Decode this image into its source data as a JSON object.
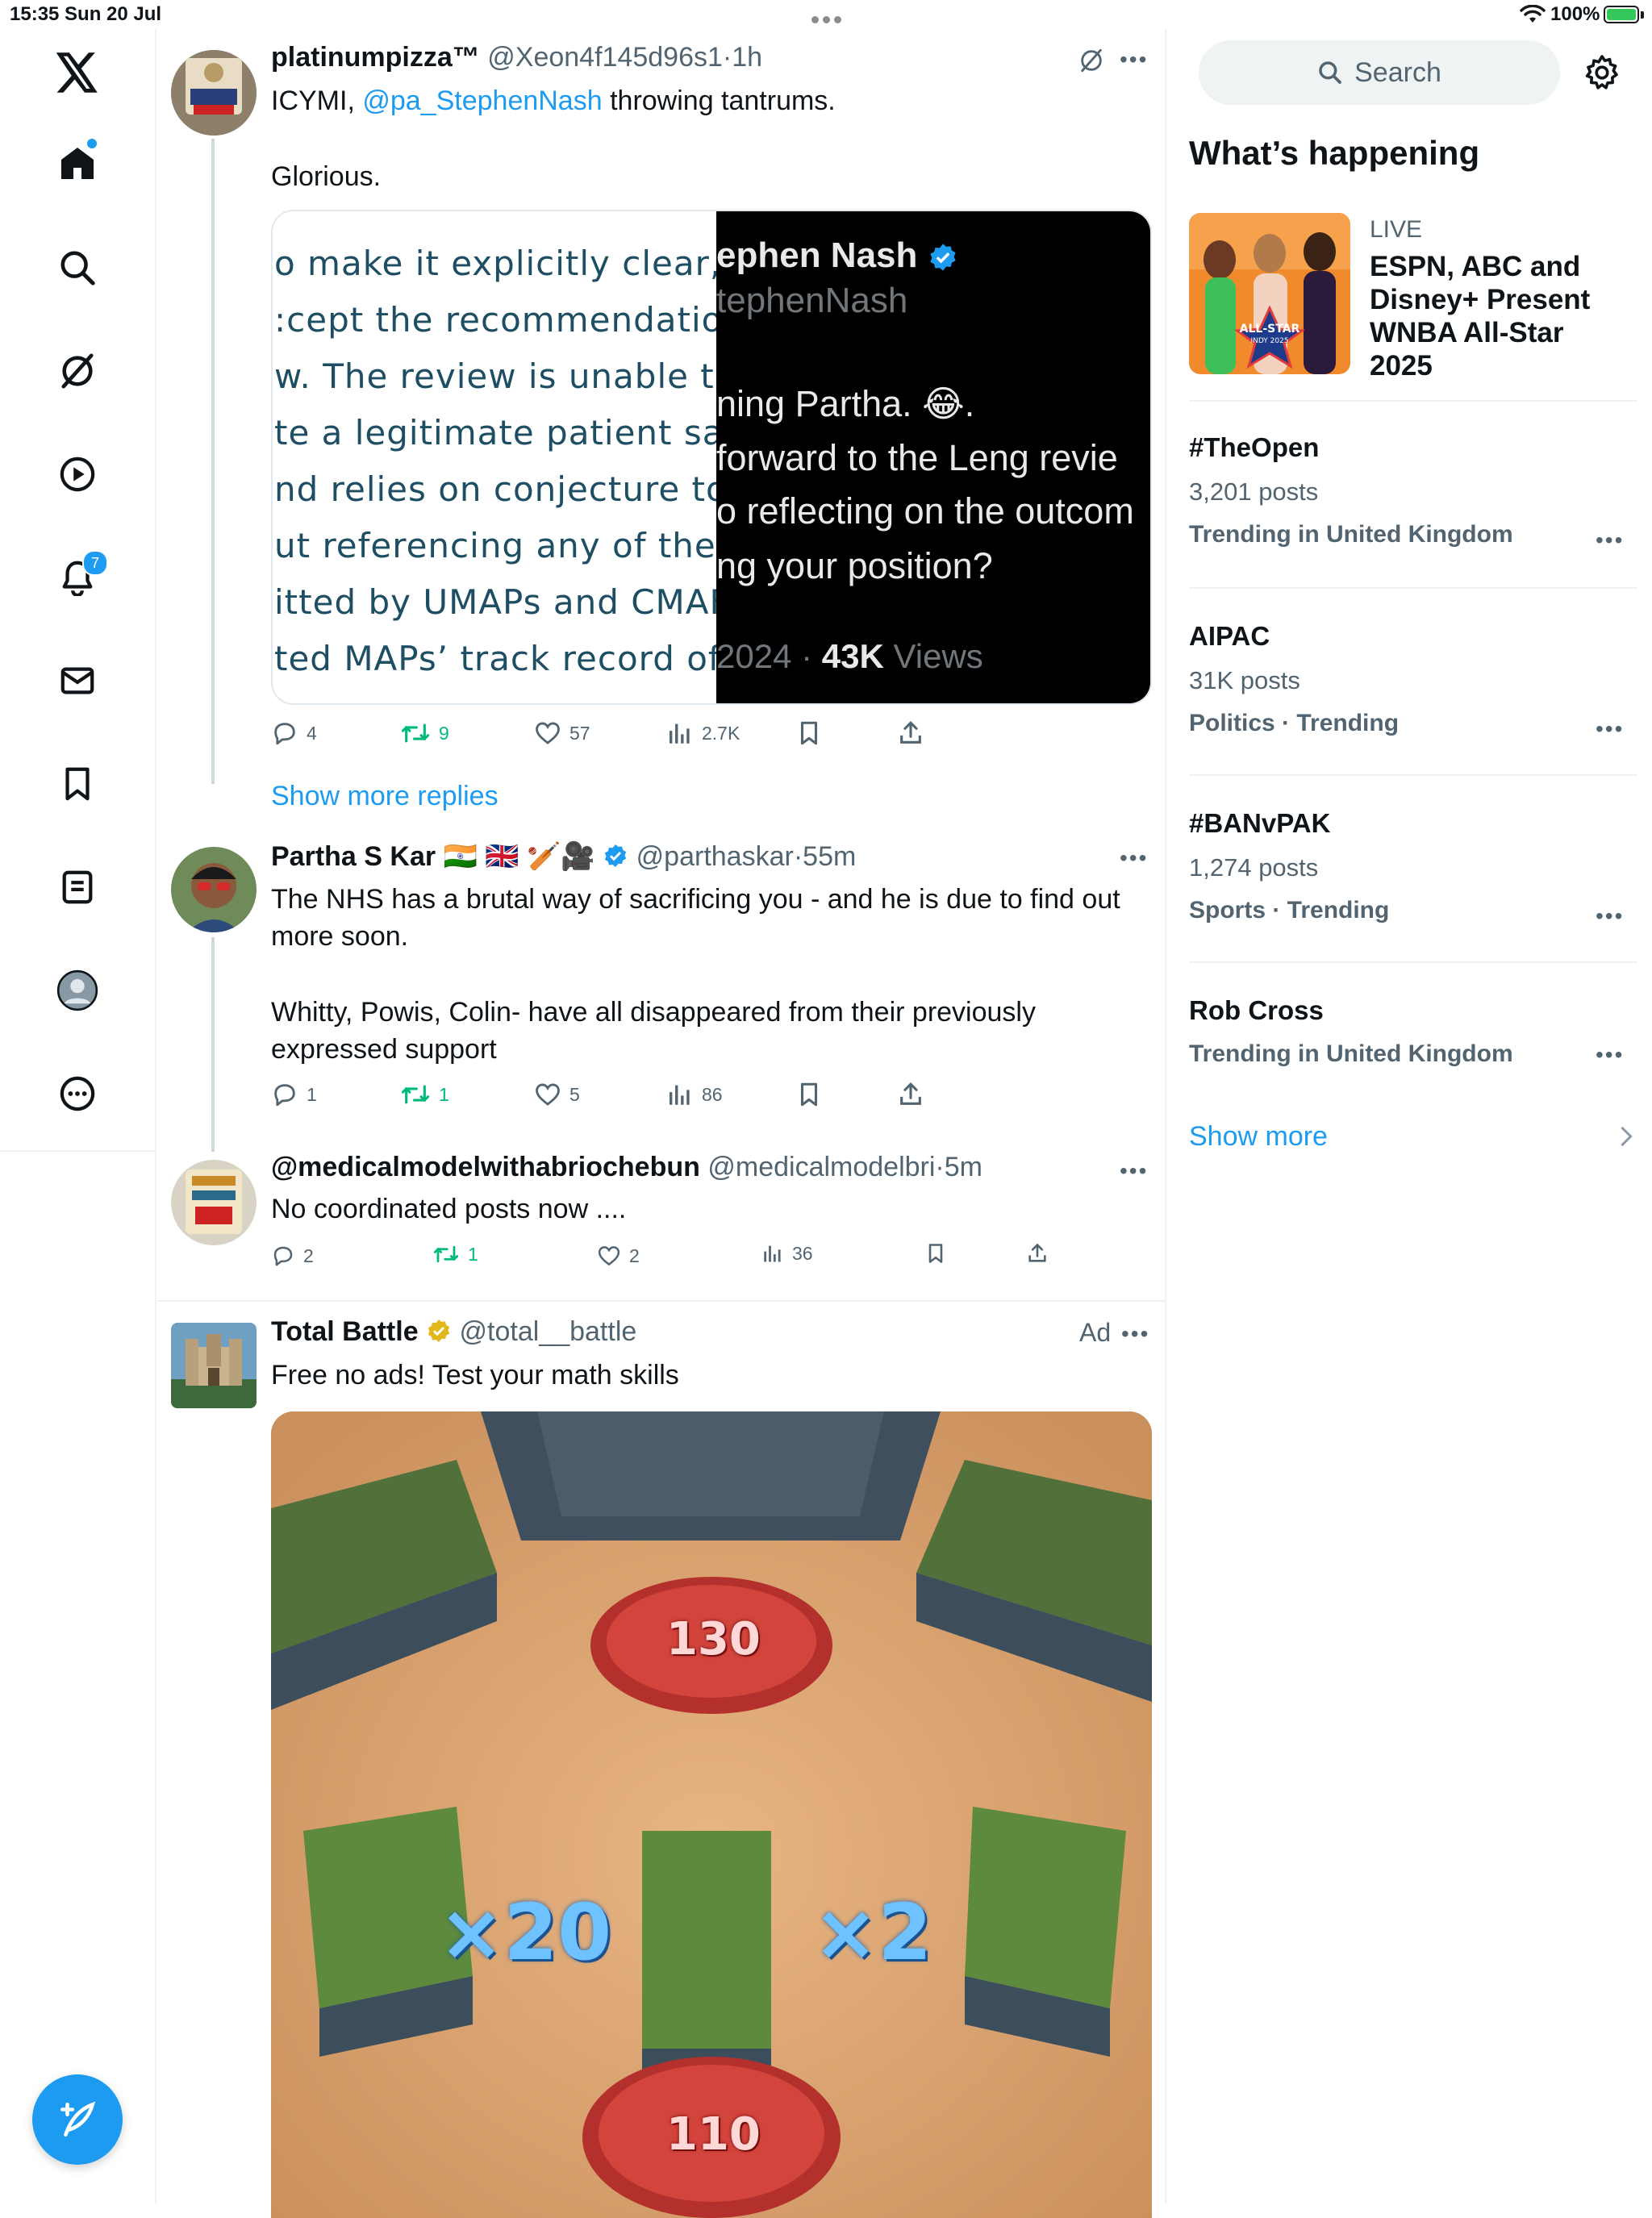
{
  "status_bar": {
    "time_date": "15:35  Sun 20 Jul",
    "battery": "100%"
  },
  "nav": {
    "notifications_badge": "7"
  },
  "posts": [
    {
      "name": "platinumpizza™",
      "handle": "@Xeon4f145d96s1",
      "time": "1h",
      "text_prefix": "ICYMI, ",
      "mention": "@pa_StephenNash",
      "text_suffix": " throwing tantrums.",
      "text_second": "Glorious.",
      "embed": {
        "left_lines": [
          "o make it explicitly clear,",
          ":cept the recommendatio",
          "w. The review is unable to",
          "te a legitimate patient saf",
          "nd relies on conjecture to",
          "ut referencing any of the",
          "itted by UMAPs and CMAF",
          "ted MAPs’ track record of"
        ],
        "right_name": "ephen Nash",
        "right_handle": "tephenNash",
        "right_lines": [
          "ning Partha. 😂.",
          "forward to the Leng revie",
          "o reflecting on the outcom",
          "ng your position?"
        ],
        "right_footer_date": "2024 · ",
        "right_footer_views_num": "43K",
        "right_footer_views": " Views"
      },
      "actions": {
        "replies": "4",
        "reposts": "9",
        "likes": "57",
        "views": "2.7K"
      }
    },
    {
      "name": "Partha S Kar 🇮🇳 🇬🇧 🏏🎥",
      "handle": "@parthaskar",
      "time": "55m",
      "text_p1": "The NHS has a brutal way of sacrificing you - and he is due to find out more soon.",
      "text_p2": "Whitty, Powis, Colin- have all disappeared from their previously expressed support",
      "actions": {
        "replies": "1",
        "reposts": "1",
        "likes": "5",
        "views": "86"
      }
    },
    {
      "name": "@medicalmodelwithabriochebun",
      "handle": "@medicalmodelbri",
      "time": "5m",
      "text": "No coordinated posts now ....",
      "actions": {
        "replies": "2",
        "reposts": "1",
        "likes": "2",
        "views": "36"
      }
    },
    {
      "name": "Total Battle",
      "handle": "@total__battle",
      "ad_label": "Ad",
      "text": "Free no ads! Test your math skills",
      "image_labels": {
        "top_num": "130",
        "mult_left": "×20",
        "mult_right": "×2",
        "bottom_num": "110"
      }
    }
  ],
  "show_more_replies": "Show more replies",
  "right": {
    "search_placeholder": "Search",
    "section_title": "What’s happening",
    "live": {
      "label": "LIVE",
      "title": "ESPN, ABC and Disney+ Present WNBA All-Star 2025",
      "thumb_text_1": "ALL-STAR",
      "thumb_text_2": "INDY 2025"
    },
    "trends": [
      {
        "title": "#TheOpen",
        "count": "3,201 posts",
        "meta": "Trending in United Kingdom"
      },
      {
        "title": "AIPAC",
        "count": "31K posts",
        "meta": "Politics · Trending"
      },
      {
        "title": "#BANvPAK",
        "count": "1,274 posts",
        "meta": "Sports · Trending"
      },
      {
        "title": "Rob Cross",
        "count": "",
        "meta": "Trending in United Kingdom"
      }
    ],
    "show_more": "Show more"
  },
  "colors": {
    "accent": "#1d9bf0",
    "repost_green": "#00ba7c",
    "text_secondary": "#536471",
    "border": "#eff3f4"
  }
}
